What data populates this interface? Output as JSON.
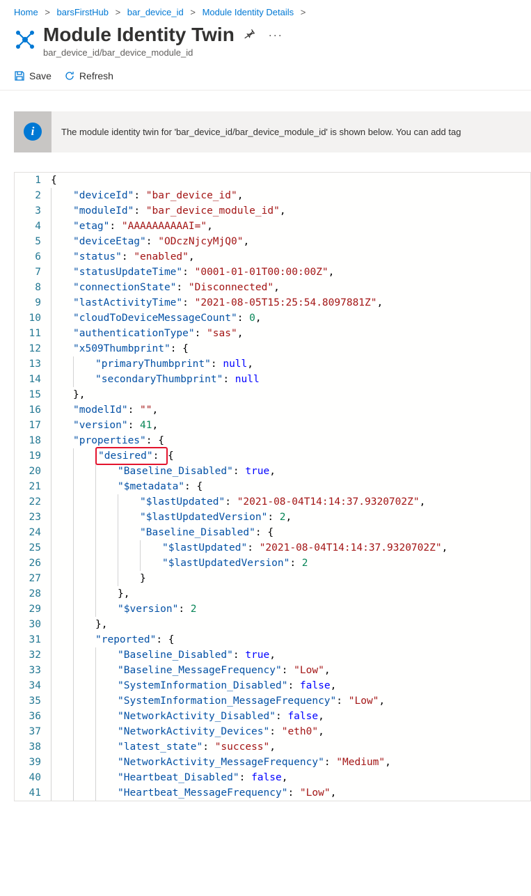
{
  "breadcrumb": {
    "items": [
      "Home",
      "barsFirstHub",
      "bar_device_id",
      "Module Identity Details"
    ],
    "sep": ">"
  },
  "header": {
    "title": "Module Identity Twin",
    "subtitle": "bar_device_id/bar_device_module_id"
  },
  "toolbar": {
    "save_label": "Save",
    "refresh_label": "Refresh"
  },
  "banner": {
    "text": "The module identity twin for 'bar_device_id/bar_device_module_id' is shown below. You can add tag"
  },
  "editor": {
    "lines": [
      {
        "n": 1,
        "ind": 0,
        "toks": [
          [
            "brace",
            "{"
          ]
        ]
      },
      {
        "n": 2,
        "ind": 1,
        "toks": [
          [
            "key",
            "\"deviceId\""
          ],
          [
            "punct",
            ": "
          ],
          [
            "str",
            "\"bar_device_id\""
          ],
          [
            "punct",
            ","
          ]
        ]
      },
      {
        "n": 3,
        "ind": 1,
        "toks": [
          [
            "key",
            "\"moduleId\""
          ],
          [
            "punct",
            ": "
          ],
          [
            "str",
            "\"bar_device_module_id\""
          ],
          [
            "punct",
            ","
          ]
        ]
      },
      {
        "n": 4,
        "ind": 1,
        "toks": [
          [
            "key",
            "\"etag\""
          ],
          [
            "punct",
            ": "
          ],
          [
            "str",
            "\"AAAAAAAAAAI=\""
          ],
          [
            "punct",
            ","
          ]
        ]
      },
      {
        "n": 5,
        "ind": 1,
        "toks": [
          [
            "key",
            "\"deviceEtag\""
          ],
          [
            "punct",
            ": "
          ],
          [
            "str",
            "\"ODczNjcyMjQ0\""
          ],
          [
            "punct",
            ","
          ]
        ]
      },
      {
        "n": 6,
        "ind": 1,
        "toks": [
          [
            "key",
            "\"status\""
          ],
          [
            "punct",
            ": "
          ],
          [
            "str",
            "\"enabled\""
          ],
          [
            "punct",
            ","
          ]
        ]
      },
      {
        "n": 7,
        "ind": 1,
        "toks": [
          [
            "key",
            "\"statusUpdateTime\""
          ],
          [
            "punct",
            ": "
          ],
          [
            "str",
            "\"0001-01-01T00:00:00Z\""
          ],
          [
            "punct",
            ","
          ]
        ]
      },
      {
        "n": 8,
        "ind": 1,
        "toks": [
          [
            "key",
            "\"connectionState\""
          ],
          [
            "punct",
            ": "
          ],
          [
            "str",
            "\"Disconnected\""
          ],
          [
            "punct",
            ","
          ]
        ]
      },
      {
        "n": 9,
        "ind": 1,
        "toks": [
          [
            "key",
            "\"lastActivityTime\""
          ],
          [
            "punct",
            ": "
          ],
          [
            "str",
            "\"2021-08-05T15:25:54.8097881Z\""
          ],
          [
            "punct",
            ","
          ]
        ]
      },
      {
        "n": 10,
        "ind": 1,
        "toks": [
          [
            "key",
            "\"cloudToDeviceMessageCount\""
          ],
          [
            "punct",
            ": "
          ],
          [
            "num",
            "0"
          ],
          [
            "punct",
            ","
          ]
        ]
      },
      {
        "n": 11,
        "ind": 1,
        "toks": [
          [
            "key",
            "\"authenticationType\""
          ],
          [
            "punct",
            ": "
          ],
          [
            "str",
            "\"sas\""
          ],
          [
            "punct",
            ","
          ]
        ]
      },
      {
        "n": 12,
        "ind": 1,
        "toks": [
          [
            "key",
            "\"x509Thumbprint\""
          ],
          [
            "punct",
            ": "
          ],
          [
            "brace",
            "{"
          ]
        ]
      },
      {
        "n": 13,
        "ind": 2,
        "toks": [
          [
            "key",
            "\"primaryThumbprint\""
          ],
          [
            "punct",
            ": "
          ],
          [
            "null",
            "null"
          ],
          [
            "punct",
            ","
          ]
        ]
      },
      {
        "n": 14,
        "ind": 2,
        "toks": [
          [
            "key",
            "\"secondaryThumbprint\""
          ],
          [
            "punct",
            ": "
          ],
          [
            "null",
            "null"
          ]
        ]
      },
      {
        "n": 15,
        "ind": 1,
        "toks": [
          [
            "brace",
            "}"
          ],
          [
            "punct",
            ","
          ]
        ]
      },
      {
        "n": 16,
        "ind": 1,
        "toks": [
          [
            "key",
            "\"modelId\""
          ],
          [
            "punct",
            ": "
          ],
          [
            "str",
            "\"\""
          ],
          [
            "punct",
            ","
          ]
        ]
      },
      {
        "n": 17,
        "ind": 1,
        "toks": [
          [
            "key",
            "\"version\""
          ],
          [
            "punct",
            ": "
          ],
          [
            "num",
            "41"
          ],
          [
            "punct",
            ","
          ]
        ]
      },
      {
        "n": 18,
        "ind": 1,
        "toks": [
          [
            "key",
            "\"properties\""
          ],
          [
            "punct",
            ": "
          ],
          [
            "brace",
            "{"
          ]
        ]
      },
      {
        "n": 19,
        "ind": 2,
        "hl": true,
        "toks": [
          [
            "key",
            "\"desired\""
          ],
          [
            "punct",
            ": "
          ],
          [
            "brace",
            "{"
          ]
        ]
      },
      {
        "n": 20,
        "ind": 3,
        "toks": [
          [
            "key",
            "\"Baseline_Disabled\""
          ],
          [
            "punct",
            ": "
          ],
          [
            "bool",
            "true"
          ],
          [
            "punct",
            ","
          ]
        ]
      },
      {
        "n": 21,
        "ind": 3,
        "toks": [
          [
            "key",
            "\"$metadata\""
          ],
          [
            "punct",
            ": "
          ],
          [
            "brace",
            "{"
          ]
        ]
      },
      {
        "n": 22,
        "ind": 4,
        "toks": [
          [
            "key",
            "\"$lastUpdated\""
          ],
          [
            "punct",
            ": "
          ],
          [
            "str",
            "\"2021-08-04T14:14:37.9320702Z\""
          ],
          [
            "punct",
            ","
          ]
        ]
      },
      {
        "n": 23,
        "ind": 4,
        "toks": [
          [
            "key",
            "\"$lastUpdatedVersion\""
          ],
          [
            "punct",
            ": "
          ],
          [
            "num",
            "2"
          ],
          [
            "punct",
            ","
          ]
        ]
      },
      {
        "n": 24,
        "ind": 4,
        "toks": [
          [
            "key",
            "\"Baseline_Disabled\""
          ],
          [
            "punct",
            ": "
          ],
          [
            "brace",
            "{"
          ]
        ]
      },
      {
        "n": 25,
        "ind": 5,
        "toks": [
          [
            "key",
            "\"$lastUpdated\""
          ],
          [
            "punct",
            ": "
          ],
          [
            "str",
            "\"2021-08-04T14:14:37.9320702Z\""
          ],
          [
            "punct",
            ","
          ]
        ]
      },
      {
        "n": 26,
        "ind": 5,
        "toks": [
          [
            "key",
            "\"$lastUpdatedVersion\""
          ],
          [
            "punct",
            ": "
          ],
          [
            "num",
            "2"
          ]
        ]
      },
      {
        "n": 27,
        "ind": 4,
        "toks": [
          [
            "brace",
            "}"
          ]
        ]
      },
      {
        "n": 28,
        "ind": 3,
        "toks": [
          [
            "brace",
            "}"
          ],
          [
            "punct",
            ","
          ]
        ]
      },
      {
        "n": 29,
        "ind": 3,
        "toks": [
          [
            "key",
            "\"$version\""
          ],
          [
            "punct",
            ": "
          ],
          [
            "num",
            "2"
          ]
        ]
      },
      {
        "n": 30,
        "ind": 2,
        "toks": [
          [
            "brace",
            "}"
          ],
          [
            "punct",
            ","
          ]
        ]
      },
      {
        "n": 31,
        "ind": 2,
        "toks": [
          [
            "key",
            "\"reported\""
          ],
          [
            "punct",
            ": "
          ],
          [
            "brace",
            "{"
          ]
        ]
      },
      {
        "n": 32,
        "ind": 3,
        "toks": [
          [
            "key",
            "\"Baseline_Disabled\""
          ],
          [
            "punct",
            ": "
          ],
          [
            "bool",
            "true"
          ],
          [
            "punct",
            ","
          ]
        ]
      },
      {
        "n": 33,
        "ind": 3,
        "toks": [
          [
            "key",
            "\"Baseline_MessageFrequency\""
          ],
          [
            "punct",
            ": "
          ],
          [
            "str",
            "\"Low\""
          ],
          [
            "punct",
            ","
          ]
        ]
      },
      {
        "n": 34,
        "ind": 3,
        "toks": [
          [
            "key",
            "\"SystemInformation_Disabled\""
          ],
          [
            "punct",
            ": "
          ],
          [
            "bool",
            "false"
          ],
          [
            "punct",
            ","
          ]
        ]
      },
      {
        "n": 35,
        "ind": 3,
        "toks": [
          [
            "key",
            "\"SystemInformation_MessageFrequency\""
          ],
          [
            "punct",
            ": "
          ],
          [
            "str",
            "\"Low\""
          ],
          [
            "punct",
            ","
          ]
        ]
      },
      {
        "n": 36,
        "ind": 3,
        "toks": [
          [
            "key",
            "\"NetworkActivity_Disabled\""
          ],
          [
            "punct",
            ": "
          ],
          [
            "bool",
            "false"
          ],
          [
            "punct",
            ","
          ]
        ]
      },
      {
        "n": 37,
        "ind": 3,
        "toks": [
          [
            "key",
            "\"NetworkActivity_Devices\""
          ],
          [
            "punct",
            ": "
          ],
          [
            "str",
            "\"eth0\""
          ],
          [
            "punct",
            ","
          ]
        ]
      },
      {
        "n": 38,
        "ind": 3,
        "toks": [
          [
            "key",
            "\"latest_state\""
          ],
          [
            "punct",
            ": "
          ],
          [
            "str",
            "\"success\""
          ],
          [
            "punct",
            ","
          ]
        ]
      },
      {
        "n": 39,
        "ind": 3,
        "toks": [
          [
            "key",
            "\"NetworkActivity_MessageFrequency\""
          ],
          [
            "punct",
            ": "
          ],
          [
            "str",
            "\"Medium\""
          ],
          [
            "punct",
            ","
          ]
        ]
      },
      {
        "n": 40,
        "ind": 3,
        "toks": [
          [
            "key",
            "\"Heartbeat_Disabled\""
          ],
          [
            "punct",
            ": "
          ],
          [
            "bool",
            "false"
          ],
          [
            "punct",
            ","
          ]
        ]
      },
      {
        "n": 41,
        "ind": 3,
        "toks": [
          [
            "key",
            "\"Heartbeat_MessageFrequency\""
          ],
          [
            "punct",
            ": "
          ],
          [
            "str",
            "\"Low\""
          ],
          [
            "punct",
            ","
          ]
        ]
      }
    ]
  }
}
